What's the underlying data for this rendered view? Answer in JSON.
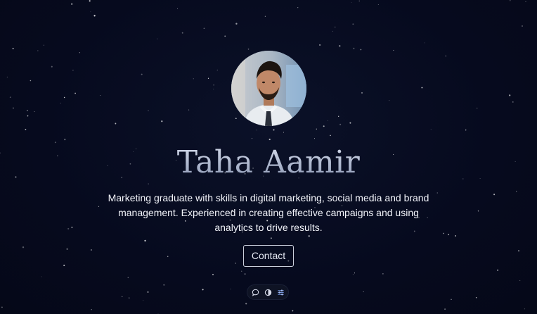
{
  "profile": {
    "name": "Taha Aamir",
    "bio": "Marketing graduate with skills in digital marketing, social media and brand management. Experienced in creating effective campaigns and using analytics to drive results.",
    "avatar_icon": "profile-photo"
  },
  "actions": {
    "contact_label": "Contact"
  },
  "toolbar": {
    "items": [
      {
        "icon": "chat-icon"
      },
      {
        "icon": "theme-toggle-icon"
      },
      {
        "icon": "settings-sliders-icon"
      }
    ]
  },
  "colors": {
    "background": "#060a1e",
    "name_gradient_top": "#d6dcec",
    "name_gradient_bottom": "#8e9ab6",
    "text": "#f2f4fa",
    "button_border": "#c9cfdc"
  }
}
